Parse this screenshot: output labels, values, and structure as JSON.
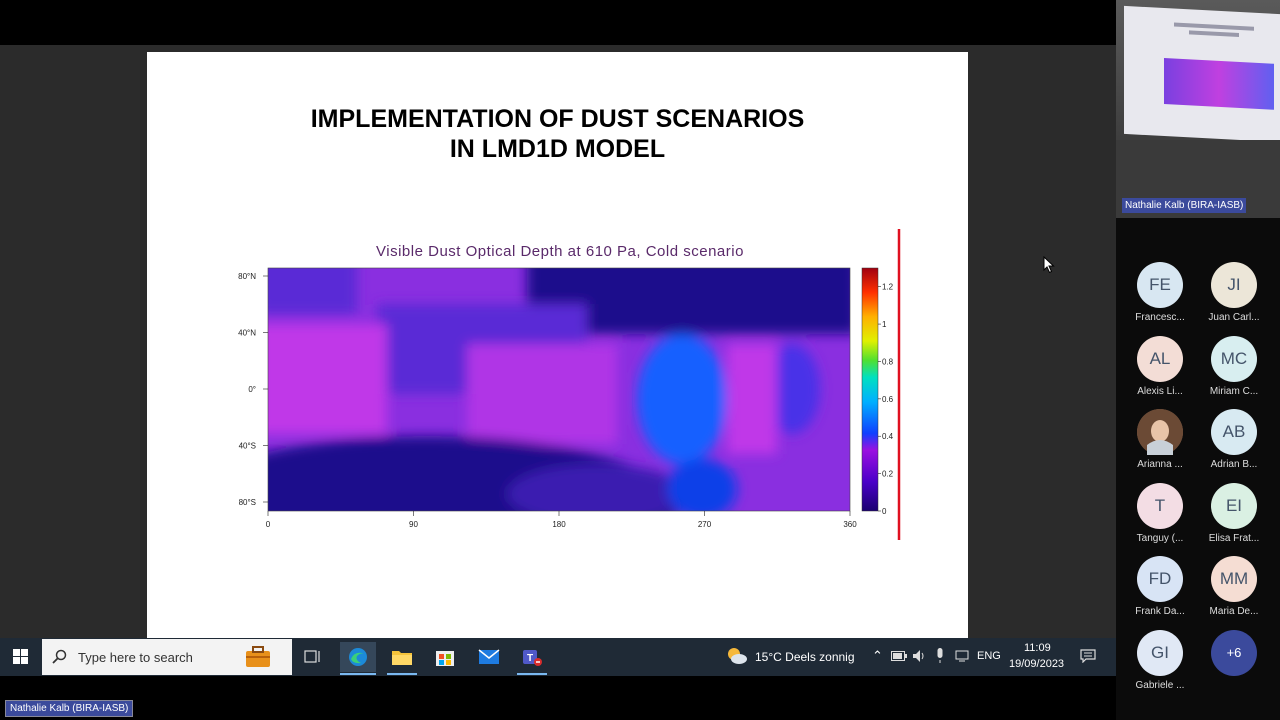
{
  "slide": {
    "title_line1": "IMPLEMENTATION OF DUST SCENARIOS",
    "title_line2": "IN LMD1D MODEL"
  },
  "chart_data": {
    "type": "heatmap",
    "title": "Visible Dust Optical Depth at 610 Pa, Cold scenario",
    "x_ticks": [
      "0",
      "90",
      "180",
      "270",
      "360"
    ],
    "y_ticks": [
      "80°N",
      "40°N",
      "0°",
      "40°S",
      "80°S"
    ],
    "colorbar_ticks": [
      "1.2",
      "1",
      "0.8",
      "0.6",
      "0.4",
      "0.2",
      "0"
    ],
    "xlim": [
      0,
      360
    ],
    "colorbar_range": [
      0,
      1.3
    ],
    "colors": [
      "#1a0a8c",
      "#2a1cb0",
      "#5a2ad6",
      "#8a2fe0",
      "#c038e8",
      "#1560ff",
      "#0a40e8"
    ]
  },
  "taskbar": {
    "search_placeholder": "Type here to search",
    "weather": "15°C  Deels zonnig",
    "language": "ENG",
    "time": "11:09",
    "date": "19/09/2023"
  },
  "meeting": {
    "presenter_label": "Nathalie Kalb (BIRA-IASB)",
    "video_label": "Nathalie Kalb (BIRA-IASB)",
    "participants": [
      {
        "initials": "FE",
        "name": "Francesc...",
        "bg": "#d8e7f2"
      },
      {
        "initials": "JI",
        "name": "Juan Carl...",
        "bg": "#ece6d8"
      },
      {
        "initials": "AL",
        "name": "Alexis Li...",
        "bg": "#f3ddd6"
      },
      {
        "initials": "MC",
        "name": "Miriam C...",
        "bg": "#d8eef0"
      },
      {
        "initials": "",
        "name": "Arianna ...",
        "bg": "#8a6a55"
      },
      {
        "initials": "AB",
        "name": "Adrian B...",
        "bg": "#d8eaf2"
      },
      {
        "initials": "T",
        "name": "Tanguy (...",
        "bg": "#f3dde4"
      },
      {
        "initials": "EI",
        "name": "Elisa Frat...",
        "bg": "#daf0e3"
      },
      {
        "initials": "FD",
        "name": "Frank Da...",
        "bg": "#d8e4f5"
      },
      {
        "initials": "MM",
        "name": "Maria De...",
        "bg": "#f5ddd3"
      },
      {
        "initials": "GI",
        "name": "Gabriele ...",
        "bg": "#e0e8f5"
      },
      {
        "initials": "+6",
        "name": "",
        "bg": "#3b4a9c"
      }
    ]
  }
}
